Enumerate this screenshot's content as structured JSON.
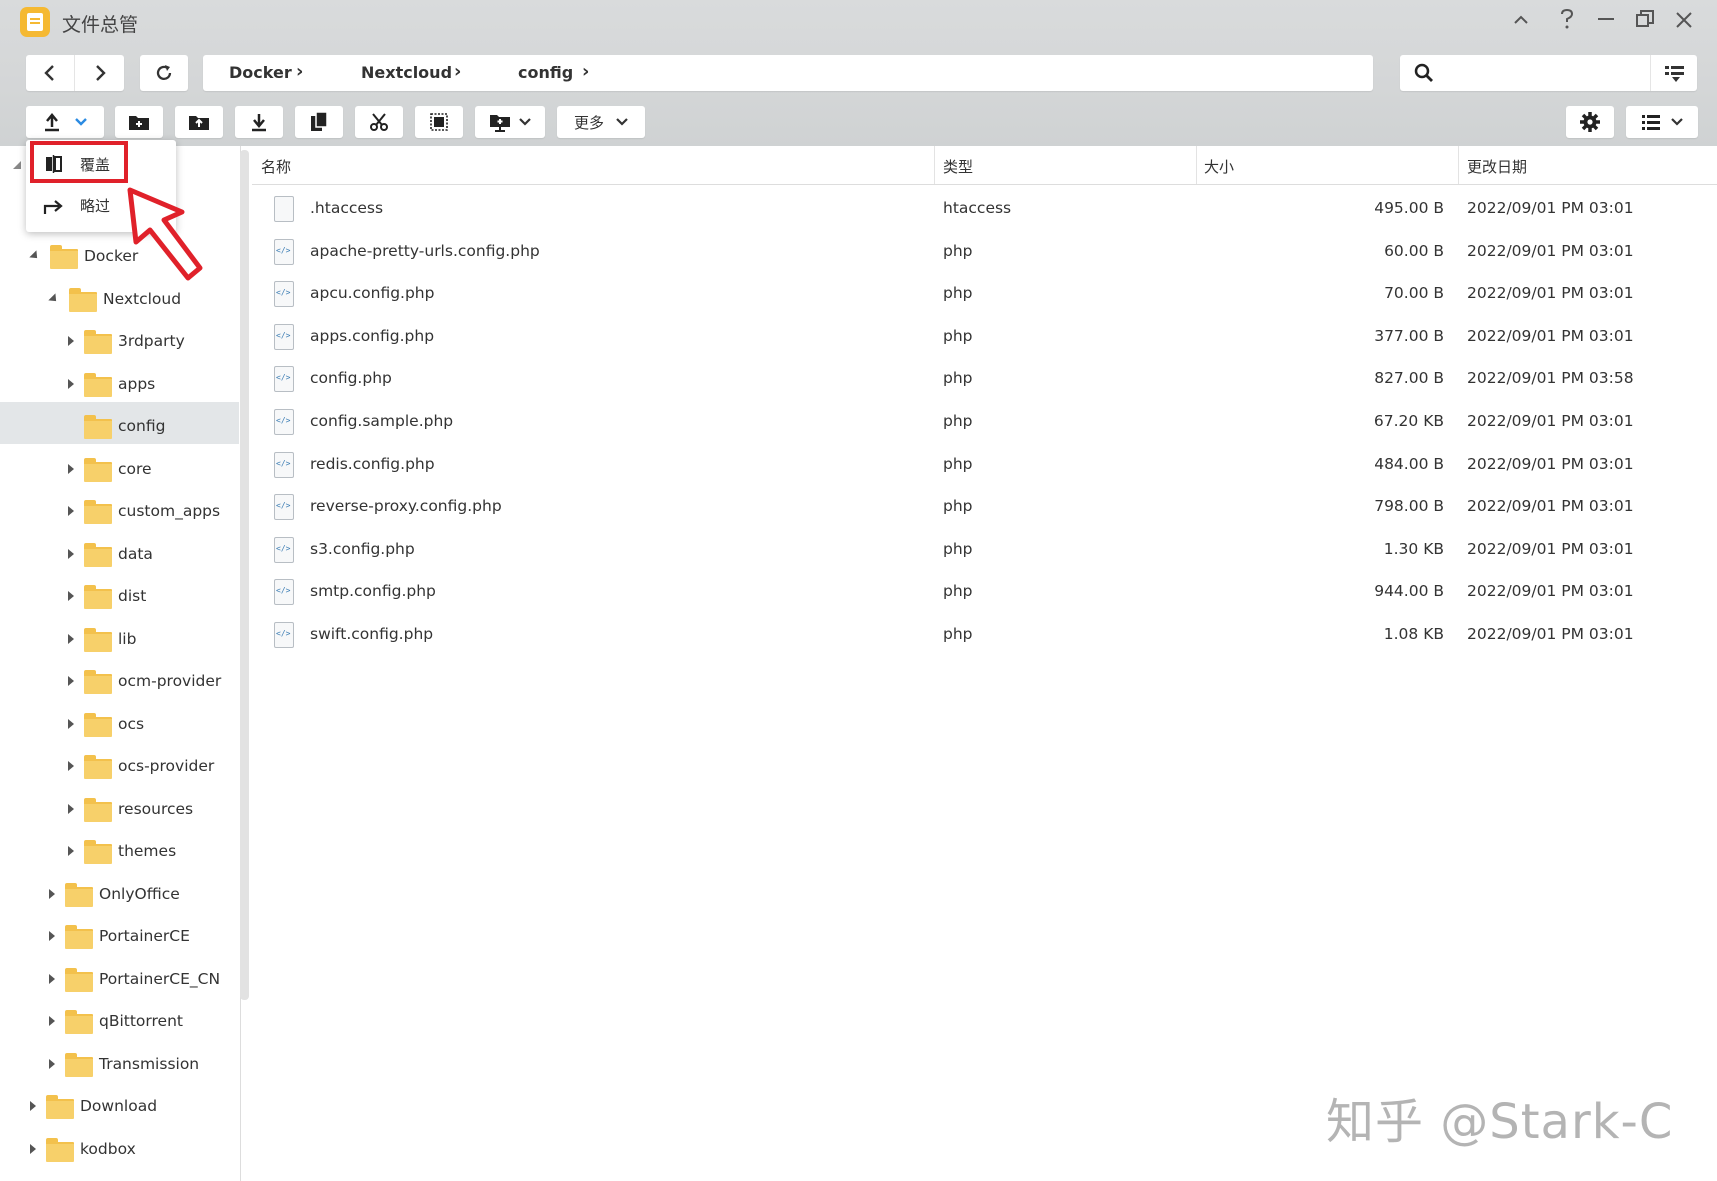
{
  "window": {
    "title": "文件总管"
  },
  "breadcrumb": [
    "Docker",
    "Nextcloud",
    "config"
  ],
  "search": {
    "placeholder": ""
  },
  "toolbar": {
    "more_label": "更多"
  },
  "dropdown": {
    "items": [
      "覆盖",
      "略过"
    ]
  },
  "tree": {
    "items": [
      {
        "label": "Docker",
        "level": 0,
        "expanded": true
      },
      {
        "label": "Nextcloud",
        "level": 1,
        "expanded": true
      },
      {
        "label": "3rdparty",
        "level": 2
      },
      {
        "label": "apps",
        "level": 2
      },
      {
        "label": "config",
        "level": 2,
        "selected": true
      },
      {
        "label": "core",
        "level": 2
      },
      {
        "label": "custom_apps",
        "level": 2
      },
      {
        "label": "data",
        "level": 2
      },
      {
        "label": "dist",
        "level": 2
      },
      {
        "label": "lib",
        "level": 2
      },
      {
        "label": "ocm-provider",
        "level": 2
      },
      {
        "label": "ocs",
        "level": 2
      },
      {
        "label": "ocs-provider",
        "level": 2
      },
      {
        "label": "resources",
        "level": 2
      },
      {
        "label": "themes",
        "level": 2
      },
      {
        "label": "OnlyOffice",
        "level": 1
      },
      {
        "label": "PortainerCE",
        "level": 1
      },
      {
        "label": "PortainerCE_CN",
        "level": 1
      },
      {
        "label": "qBittorrent",
        "level": 1
      },
      {
        "label": "Transmission",
        "level": 1
      },
      {
        "label": "Download",
        "level": 0
      },
      {
        "label": "kodbox",
        "level": 0
      }
    ]
  },
  "table": {
    "columns": [
      "名称",
      "类型",
      "大小",
      "更改日期"
    ],
    "rows": [
      {
        "name": ".htaccess",
        "type": "htaccess",
        "size": "495.00 B",
        "date": "2022/09/01 PM 03:01"
      },
      {
        "name": "apache-pretty-urls.config.php",
        "type": "php",
        "size": "60.00 B",
        "date": "2022/09/01 PM 03:01"
      },
      {
        "name": "apcu.config.php",
        "type": "php",
        "size": "70.00 B",
        "date": "2022/09/01 PM 03:01"
      },
      {
        "name": "apps.config.php",
        "type": "php",
        "size": "377.00 B",
        "date": "2022/09/01 PM 03:01"
      },
      {
        "name": "config.php",
        "type": "php",
        "size": "827.00 B",
        "date": "2022/09/01 PM 03:58"
      },
      {
        "name": "config.sample.php",
        "type": "php",
        "size": "67.20 KB",
        "date": "2022/09/01 PM 03:01"
      },
      {
        "name": "redis.config.php",
        "type": "php",
        "size": "484.00 B",
        "date": "2022/09/01 PM 03:01"
      },
      {
        "name": "reverse-proxy.config.php",
        "type": "php",
        "size": "798.00 B",
        "date": "2022/09/01 PM 03:01"
      },
      {
        "name": "s3.config.php",
        "type": "php",
        "size": "1.30 KB",
        "date": "2022/09/01 PM 03:01"
      },
      {
        "name": "smtp.config.php",
        "type": "php",
        "size": "944.00 B",
        "date": "2022/09/01 PM 03:01"
      },
      {
        "name": "swift.config.php",
        "type": "php",
        "size": "1.08 KB",
        "date": "2022/09/01 PM 03:01"
      }
    ]
  },
  "watermark": "知乎 @Stark-C",
  "colors": {
    "highlight": "#e0212a",
    "folder": "#f7d06a",
    "selected_bg": "#e3e6e8"
  }
}
